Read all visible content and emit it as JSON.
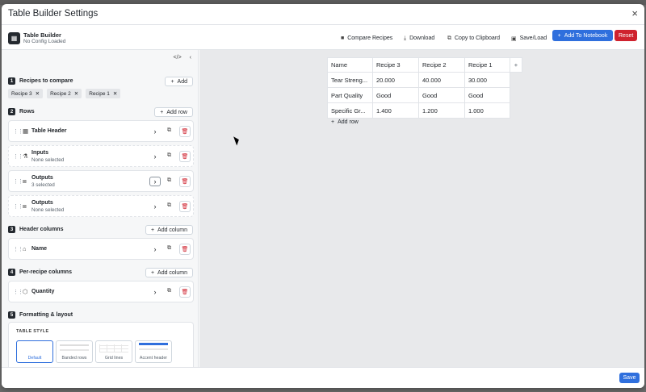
{
  "modal": {
    "title": "Table Builder Settings",
    "close_label": "×"
  },
  "app": {
    "name": "Table Builder",
    "subtitle": "No Config Loaded"
  },
  "toolbar": {
    "compare": "Compare Recipes",
    "download": "Download",
    "copy": "Copy to Clipboard",
    "saveload": "Save/Load",
    "add_notebook": "Add To Notebook",
    "reset": "Reset"
  },
  "sections": {
    "recipes": {
      "num": "1",
      "label": "Recipes to compare",
      "button": "Add"
    },
    "rows": {
      "num": "2",
      "label": "Rows",
      "button": "Add row"
    },
    "header_columns": {
      "num": "3",
      "label": "Header columns",
      "button": "Add column"
    },
    "per_recipe_columns": {
      "num": "4",
      "label": "Per-recipe columns",
      "button": "Add column"
    },
    "formatting": {
      "num": "5",
      "label": "Formatting & layout"
    }
  },
  "recipe_chips": [
    "Recipe 3",
    "Recipe 2",
    "Recipe 1"
  ],
  "rows": [
    {
      "title": "Table Header",
      "subtitle": ""
    },
    {
      "title": "Inputs",
      "subtitle": "None selected"
    },
    {
      "title": "Outputs",
      "subtitle": "3 selected"
    },
    {
      "title": "Outputs",
      "subtitle": "None selected"
    }
  ],
  "header_column": {
    "title": "Name"
  },
  "per_recipe_column": {
    "title": "Quantity"
  },
  "formatting": {
    "table_style_label": "TABLE STYLE",
    "options": [
      "Default",
      "Banded rows",
      "Grid lines",
      "Accent header"
    ],
    "selected": "Default"
  },
  "preview_table": {
    "headers": [
      "Name",
      "Recipe 3",
      "Recipe 2",
      "Recipe 1"
    ],
    "add_column_label": "+",
    "rows": [
      [
        "Tear Streng...",
        "20.000",
        "40.000",
        "30.000"
      ],
      [
        "Part Quality",
        "Good",
        "Good",
        "Good"
      ],
      [
        "Specific Gr...",
        "1.400",
        "1.200",
        "1.000"
      ]
    ],
    "add_row_label": "Add row"
  },
  "footer": {
    "save": "Save"
  },
  "colors": {
    "primary": "#2f6fdd",
    "danger": "#cf222e"
  }
}
